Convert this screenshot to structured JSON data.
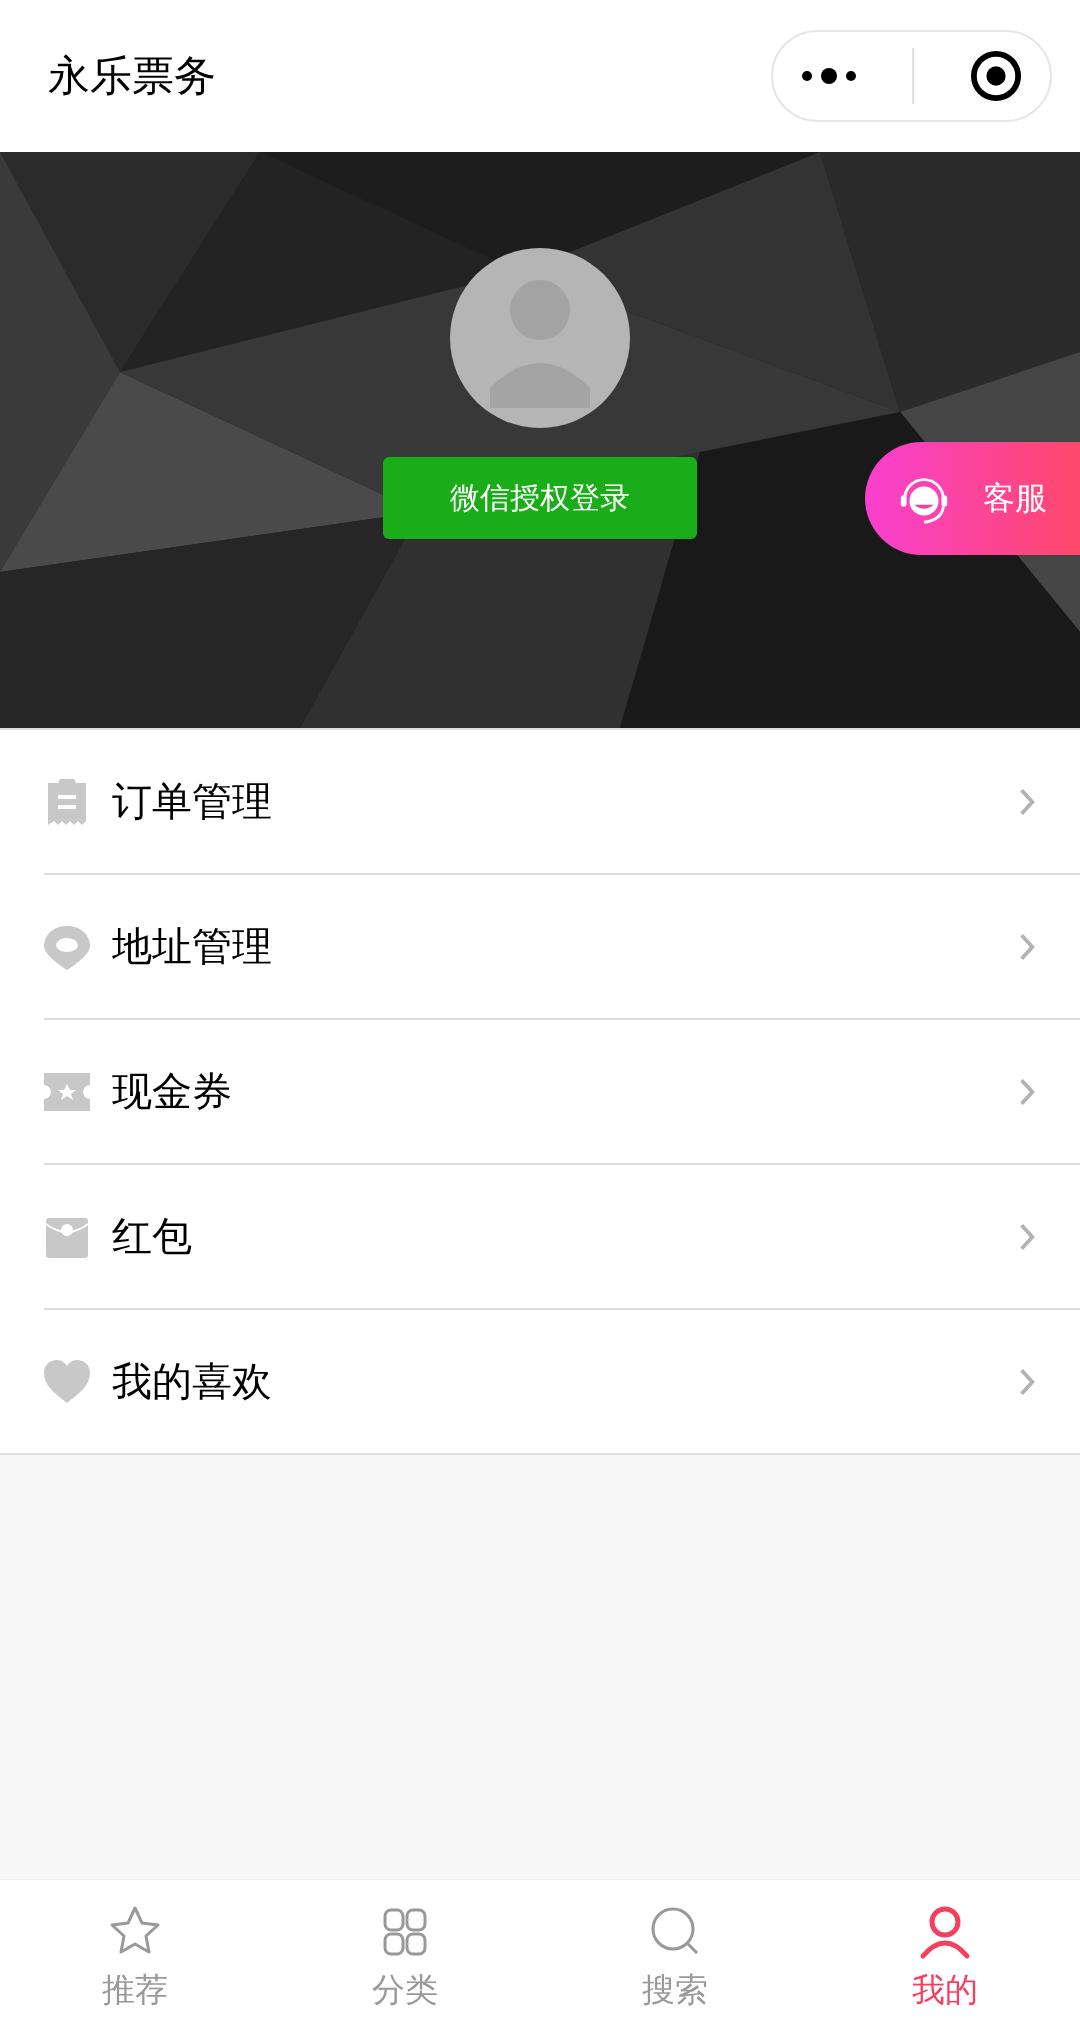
{
  "header": {
    "title": "永乐票务"
  },
  "profile": {
    "login_button": "微信授权登录",
    "service_button": "客服"
  },
  "menu": [
    {
      "kind": "order",
      "label": "订单管理"
    },
    {
      "kind": "address",
      "label": "地址管理"
    },
    {
      "kind": "coupon",
      "label": "现金券"
    },
    {
      "kind": "redpacket",
      "label": "红包"
    },
    {
      "kind": "favorite",
      "label": "我的喜欢"
    }
  ],
  "tabs": [
    {
      "kind": "star",
      "label": "推荐",
      "selected": false
    },
    {
      "kind": "grid",
      "label": "分类",
      "selected": false
    },
    {
      "kind": "search",
      "label": "搜索",
      "selected": false
    },
    {
      "kind": "user",
      "label": "我的",
      "selected": true
    }
  ]
}
